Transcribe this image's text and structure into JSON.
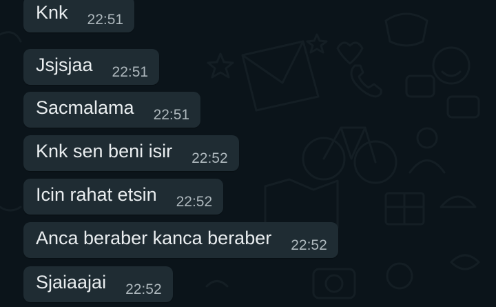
{
  "conversation": {
    "messages": [
      {
        "text": "Knk",
        "time": "22:51"
      },
      {
        "text": "Jsjsjaa",
        "time": "22:51"
      },
      {
        "text": "Sacmalama",
        "time": "22:51"
      },
      {
        "text": "Knk sen beni isir",
        "time": "22:52"
      },
      {
        "text": "Icin rahat etsin",
        "time": "22:52"
      },
      {
        "text": "Anca beraber kanca beraber",
        "time": "22:52"
      },
      {
        "text": "Sjaiaajai",
        "time": "22:52"
      }
    ]
  },
  "theme": {
    "background": "#0b141a",
    "bubble": "#1f2c33",
    "text": "#e9edef",
    "timestamp": "#aeb8bd"
  }
}
